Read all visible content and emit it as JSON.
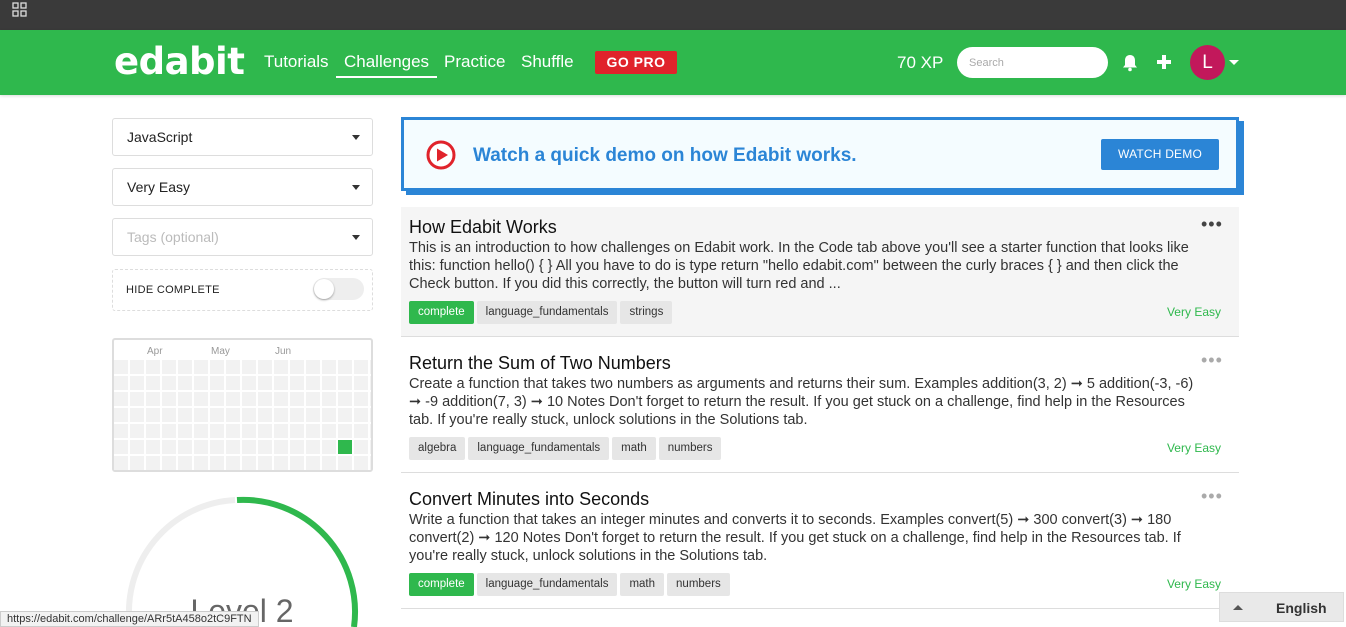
{
  "browser": {
    "apps_icon": "grid-icon",
    "status_url": "https://edabit.com/challenge/ARr5tA458o2tC9FTN"
  },
  "nav": {
    "logo": "edabit",
    "links": [
      "Tutorials",
      "Challenges",
      "Practice",
      "Shuffle"
    ],
    "active_link": "Challenges",
    "go_pro": "GO PRO",
    "xp": "70 XP",
    "search_placeholder": "Search",
    "icons": [
      "bell-icon",
      "plus-icon"
    ],
    "avatar_letter": "L",
    "avatar_color": "#c2185b",
    "brand_color": "#2fb84d"
  },
  "sidebar": {
    "language": "JavaScript",
    "difficulty": "Very Easy",
    "tags_placeholder": "Tags (optional)",
    "hide_complete_label": "HIDE COMPLETE",
    "hide_complete_on": false,
    "activity_months": [
      "Apr",
      "May",
      "Jun"
    ],
    "level_text": "Level 2"
  },
  "demo": {
    "text": "Watch a quick demo on how Edabit works.",
    "button": "WATCH DEMO",
    "accent": "#2b85d6"
  },
  "challenges": [
    {
      "title": "How Edabit Works",
      "description": "This is an introduction to how challenges on Edabit work. In the Code tab above you'll see a starter function that looks like this: function hello() { } All you have to do is type return \"hello edabit.com\" between the curly braces { } and then click the Check button. If you did this correctly, the button will turn red and ...",
      "tags": [
        "complete",
        "language_fundamentals",
        "strings"
      ],
      "difficulty": "Very Easy",
      "menu": "•••"
    },
    {
      "title": "Return the Sum of Two Numbers",
      "description": "Create a function that takes two numbers as arguments and returns their sum. Examples addition(3, 2) ➞ 5 addition(-3, -6) ➞ -9 addition(7, 3) ➞ 10 Notes Don't forget to return the result. If you get stuck on a challenge, find help in the Resources tab. If you're really stuck, unlock solutions in the Solutions tab.",
      "tags": [
        "algebra",
        "language_fundamentals",
        "math",
        "numbers"
      ],
      "difficulty": "Very Easy",
      "menu": "•••"
    },
    {
      "title": "Convert Minutes into Seconds",
      "description": "Write a function that takes an integer minutes and converts it to seconds. Examples convert(5) ➞ 300 convert(3) ➞ 180 convert(2) ➞ 120 Notes Don't forget to return the result. If you get stuck on a challenge, find help in the Resources tab. If you're really stuck, unlock solutions in the Solutions tab.",
      "tags": [
        "complete",
        "language_fundamentals",
        "math",
        "numbers"
      ],
      "difficulty": "Very Easy",
      "menu": "•••"
    }
  ],
  "language_selector": "English"
}
